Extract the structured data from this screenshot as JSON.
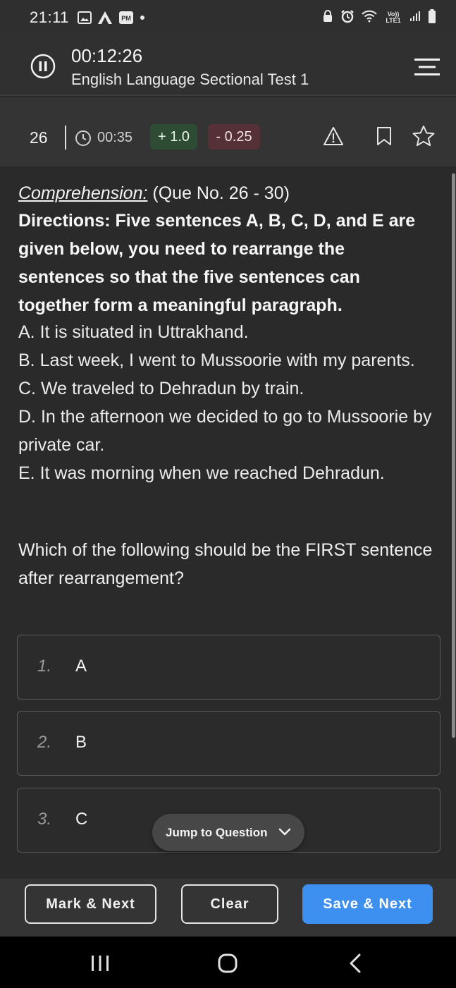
{
  "status_bar": {
    "time": "21:11",
    "pm_badge": "PM",
    "network": "Vo)) LTE1"
  },
  "header": {
    "timer": "00:12:26",
    "test_title": "English Language Sectional Test 1"
  },
  "question_bar": {
    "question_number": "26",
    "time_spent": "00:35",
    "positive_marks": "+ 1.0",
    "negative_marks": "- 0.25"
  },
  "question": {
    "comprehension_label": "Comprehension:",
    "comprehension_range": "(Que No. 26 - 30)",
    "directions": "Directions: Five sentences A, B, C, D, and E are given below, you need to rearrange the sentences so that the five sentences can together form a meaningful paragraph.",
    "sentences": [
      "A. It is situated in Uttrakhand.",
      "B. Last week, I went to Mussoorie with my parents.",
      "C. We traveled to Dehradun by train.",
      "D. In the afternoon we decided to go to Mussoorie by private car.",
      "E. It was morning when we reached Dehradun."
    ],
    "prompt": "Which of the following should be the FIRST sentence after rearrangement?"
  },
  "options": [
    {
      "number": "1.",
      "text": "A"
    },
    {
      "number": "2.",
      "text": "B"
    },
    {
      "number": "3.",
      "text": "C"
    }
  ],
  "jump_to_question": "Jump to Question",
  "actions": {
    "mark_next": "Mark & Next",
    "clear": "Clear",
    "save_next": "Save & Next"
  },
  "colors": {
    "accent": "#3d8ff0",
    "positive_badge": "#2e4b34",
    "negative_badge": "#553037",
    "background": "#2a2a2a"
  }
}
